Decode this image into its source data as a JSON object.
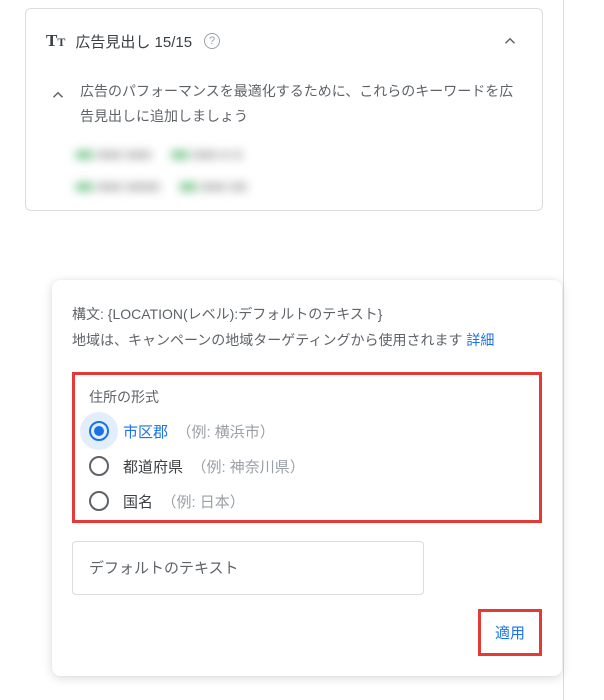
{
  "card": {
    "icon_label": "Tᴛ",
    "title": "広告見出し 15/15",
    "hint": "広告のパフォーマンスを最適化するために、これらのキーワードを広告見出しに追加しましょう"
  },
  "popover": {
    "syntax_line": "構文: {LOCATION(レベル):デフォルトのテキスト}",
    "region_line_prefix": "地域は、キャンペーンの地域ターゲティングから使用されます ",
    "detail_link": "詳細",
    "address_format_label": "住所の形式",
    "options": [
      {
        "label": "市区郡",
        "example": "（例: 横浜市）",
        "selected": true
      },
      {
        "label": "都道府県",
        "example": "（例: 神奈川県）",
        "selected": false
      },
      {
        "label": "国名",
        "example": "（例: 日本）",
        "selected": false
      }
    ],
    "default_text_placeholder": "デフォルトのテキスト",
    "apply_button": "適用"
  }
}
